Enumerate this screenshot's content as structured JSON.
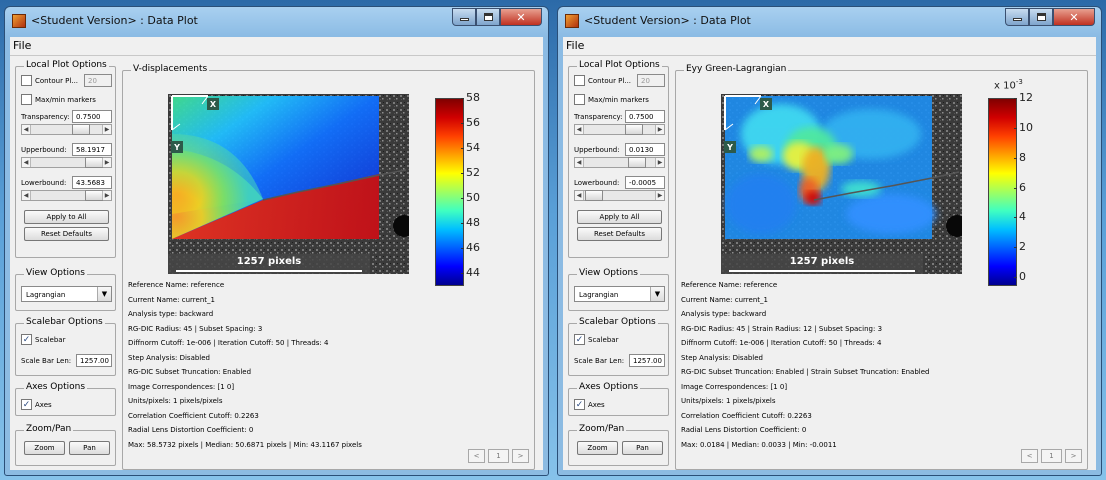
{
  "windows": [
    {
      "title": "<Student Version> : Data Plot",
      "menu": "File",
      "local": {
        "title": "Local Plot Options",
        "contour_label": "Contour Pl...",
        "contour_value": "20",
        "maxmin_label": "Max/min markers",
        "transparency_label": "Transparency:",
        "transparency_value": "0.7500",
        "transparency_slider": 0.75,
        "upper_label": "Upperbound:",
        "upper_value": "58.1917",
        "upper_slider": 0.98,
        "lower_label": "Lowerbound:",
        "lower_value": "43.5683",
        "lower_slider": 0.98,
        "apply": "Apply to All",
        "reset": "Reset Defaults"
      },
      "view": {
        "title": "View Options",
        "value": "Lagrangian"
      },
      "scalebar": {
        "title": "Scalebar Options",
        "check_label": "Scalebar",
        "len_label": "Scale Bar Len:",
        "len_value": "1257.00"
      },
      "axes": {
        "title": "Axes Options",
        "check_label": "Axes"
      },
      "zoom": {
        "title": "Zoom/Pan",
        "zoom": "Zoom",
        "pan": "Pan"
      },
      "plot": {
        "title": "V-displacements",
        "scale_text": "1257 pixels",
        "axis_x": "X",
        "axis_y": "Y",
        "cbar_exponent": "",
        "ticks": [
          "58",
          "56",
          "54",
          "52",
          "50",
          "48",
          "46",
          "44"
        ]
      },
      "info": [
        "Reference Name: reference",
        "Current Name: current_1",
        "Analysis type: backward",
        "RG-DIC Radius: 45 | Subset Spacing: 3",
        "Diffnorm Cutoff: 1e-006 | Iteration Cutoff: 50 | Threads: 4",
        "Step Analysis: Disabled",
        "RG-DIC Subset Truncation: Enabled",
        "Image Correspondences: [1 0]",
        "Units/pixels: 1 pixels/pixels",
        "Correlation Coefficient Cutoff: 0.2263",
        "Radial Lens Distortion Coefficient: 0",
        "Max: 58.5732 pixels | Median: 50.6871 pixels | Min: 43.1167 pixels"
      ],
      "pager": {
        "prev": "<",
        "page": "1",
        "next": ">"
      }
    },
    {
      "title": "<Student Version> : Data Plot",
      "menu": "File",
      "local": {
        "title": "Local Plot Options",
        "contour_label": "Contour Pl...",
        "contour_value": "20",
        "maxmin_label": "Max/min markers",
        "transparency_label": "Transparency:",
        "transparency_value": "0.7500",
        "transparency_slider": 0.75,
        "upper_label": "Upperbound:",
        "upper_value": "0.0130",
        "upper_slider": 0.8,
        "lower_label": "Lowerbound:",
        "lower_value": "-0.0005",
        "lower_slider": 0.02,
        "apply": "Apply to All",
        "reset": "Reset Defaults"
      },
      "view": {
        "title": "View Options",
        "value": "Lagrangian"
      },
      "scalebar": {
        "title": "Scalebar Options",
        "check_label": "Scalebar",
        "len_label": "Scale Bar Len:",
        "len_value": "1257.00"
      },
      "axes": {
        "title": "Axes Options",
        "check_label": "Axes"
      },
      "zoom": {
        "title": "Zoom/Pan",
        "zoom": "Zoom",
        "pan": "Pan"
      },
      "plot": {
        "title": "Eyy Green-Lagrangian",
        "scale_text": "1257 pixels",
        "axis_x": "X",
        "axis_y": "Y",
        "cbar_exponent": "x 10",
        "cbar_exponent_sup": "-3",
        "ticks": [
          "12",
          "10",
          "8",
          "6",
          "4",
          "2",
          "0"
        ]
      },
      "info": [
        "Reference Name: reference",
        "Current Name: current_1",
        "Analysis type: backward",
        "RG-DIC Radius: 45 | Strain Radius: 12 | Subset Spacing: 3",
        "Diffnorm Cutoff: 1e-006 | Iteration Cutoff: 50 | Threads: 4",
        "Step Analysis: Disabled",
        "RG-DIC Subset Truncation: Enabled | Strain Subset Truncation: Enabled",
        "Image Correspondences: [1 0]",
        "Units/pixels: 1 pixels/pixels",
        "Correlation Coefficient Cutoff: 0.2263",
        "Radial Lens Distortion Coefficient: 0",
        "Max: 0.0184 | Median: 0.0033 | Min: -0.0011"
      ],
      "pager": {
        "prev": "<",
        "page": "1",
        "next": ">"
      }
    }
  ],
  "colors": {
    "jet_top": "#800000",
    "jet_bottom": "#000090"
  }
}
